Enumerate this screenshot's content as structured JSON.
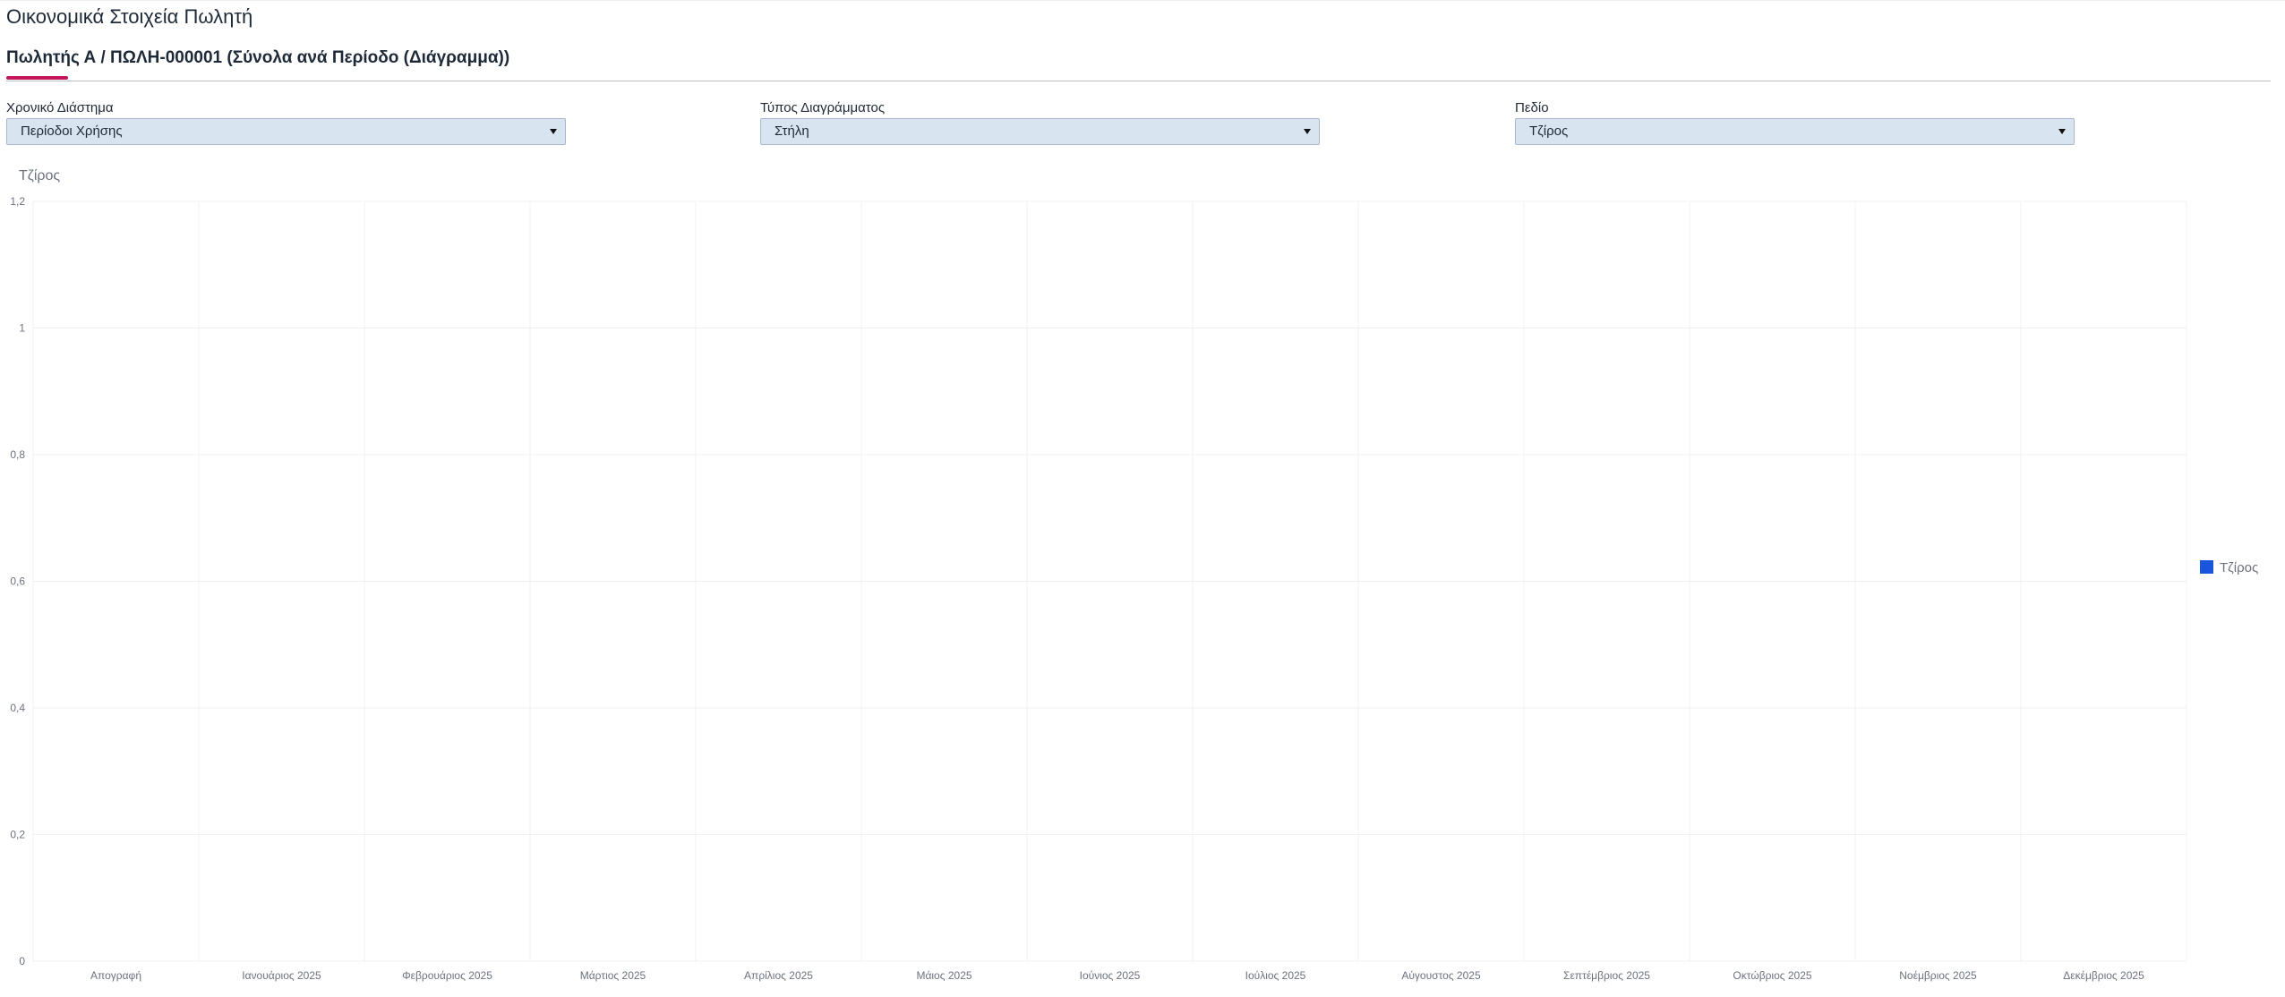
{
  "page": {
    "title": "Οικονομικά Στοιχεία Πωλητή"
  },
  "tabs": [
    {
      "label": "Πωλητής Α / ΠΩΛΗ-000001 (Σύνολα ανά Περίοδο (Διάγραμμα))",
      "active": true
    }
  ],
  "filters": {
    "period": {
      "label": "Χρονικό Διάστημα",
      "value": "Περίοδοι Χρήσης"
    },
    "chart_type": {
      "label": "Τύπος Διαγράμματος",
      "value": "Στήλη"
    },
    "field": {
      "label": "Πεδίο",
      "value": "Τζίρος"
    }
  },
  "colors": {
    "accent": "#c2185b",
    "select_bg": "#d9e4f1",
    "series": "#1a56db",
    "grid": "#f0f0f0"
  },
  "chart_data": {
    "type": "bar",
    "title": "Τζίρος",
    "categories": [
      "Απογραφή",
      "Ιανουάριος 2025",
      "Φεβρουάριος 2025",
      "Μάρτιος 2025",
      "Απρίλιος 2025",
      "Μάιος 2025",
      "Ιούνιος 2025",
      "Ιούλιος 2025",
      "Αύγουστος 2025",
      "Σεπτέμβριος 2025",
      "Οκτώβριος 2025",
      "Νοέμβριος 2025",
      "Δεκέμβριος 2025"
    ],
    "series": [
      {
        "name": "Τζίρος",
        "values": [
          0,
          0,
          0,
          0,
          0,
          0,
          0,
          0,
          0,
          0,
          0,
          0,
          0
        ]
      }
    ],
    "ylim": [
      0,
      1.2
    ],
    "yticks": [
      "0",
      "0,2",
      "0,4",
      "0,6",
      "0,8",
      "1",
      "1,2"
    ],
    "grid": true,
    "legend_position": "right"
  }
}
